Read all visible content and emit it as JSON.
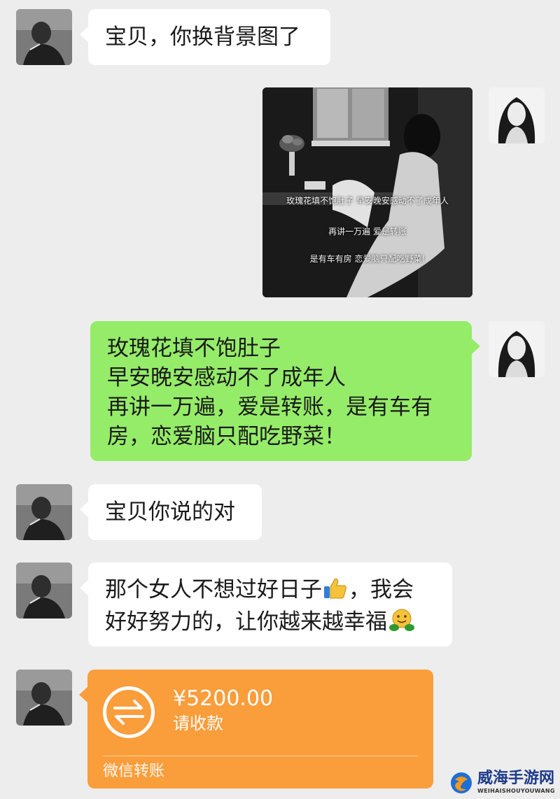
{
  "messages": [
    {
      "side": "left",
      "text": "宝贝，你换背景图了"
    },
    {
      "side": "right",
      "type": "image",
      "caption_lines": [
        "玫瑰花填不饱肚子 早安晚安感动不了成年人",
        "再讲一万遍 爱是转账",
        "是有车有房 恋爱脑只配吃野菜!"
      ]
    },
    {
      "side": "right",
      "lines": [
        "玫瑰花填不饱肚子",
        "早安晚安感动不了成年人",
        "再讲一万遍，爱是转账，是有车有",
        "房，恋爱脑只配吃野菜！"
      ]
    },
    {
      "side": "left",
      "text": "宝贝你说的对"
    },
    {
      "side": "left",
      "line1_a": "那个女人不想过好日子",
      "line1_emoji": "thumbs-up-emoji",
      "line1_b": "，我会",
      "line2": "好好努力的，让你越来越幸福",
      "line2_emoji": "hug-face-emoji"
    },
    {
      "side": "left",
      "type": "transfer",
      "amount": "¥5200.00",
      "status": "请收款",
      "footer": "微信转账",
      "icon": "transfer-arrows-icon"
    }
  ],
  "watermark": {
    "title": "威海手游网",
    "subtitle": "WEIHAISHOUYOUWANG"
  },
  "colors": {
    "background": "#ededed",
    "sent_bubble": "#95ec69",
    "received_bubble": "#ffffff",
    "transfer_card": "#fa9d3b"
  }
}
